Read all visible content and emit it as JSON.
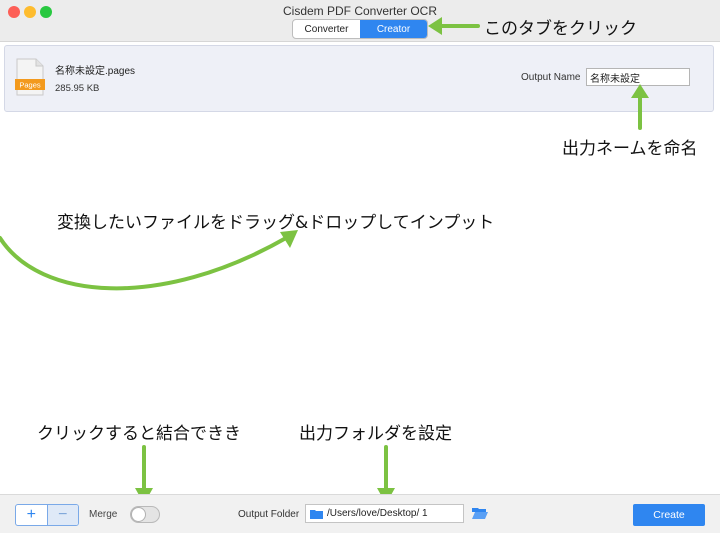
{
  "app": {
    "title": "Cisdem PDF Converter OCR"
  },
  "tabs": [
    {
      "label": "Converter",
      "active": false
    },
    {
      "label": "Creator",
      "active": true
    }
  ],
  "file": {
    "name": "名称未設定.pages",
    "size": "285.95 KB",
    "icon_label": "Pages",
    "output_name_label": "Output Name",
    "output_name_value": "名称未設定"
  },
  "annotations": {
    "tab_hint": "このタブをクリック",
    "output_hint": "出力ネームを命名",
    "drop_hint": "変換したいファイルをドラッグ&ドロップしてインプット",
    "merge_hint": "クリックすると結合できき",
    "folder_hint": "出力フォルダを設定"
  },
  "bottom": {
    "add_label": "+",
    "remove_label": "−",
    "merge_label": "Merge",
    "merge_on": false,
    "output_folder_label": "Output Folder",
    "output_folder_path": "/Users/love/Desktop/ 1",
    "create_label": "Create"
  },
  "colors": {
    "accent": "#2f86f0",
    "arrow": "#7cc242",
    "file_row_bg": "#eef0f7",
    "pages_icon": "#f39a1e"
  }
}
